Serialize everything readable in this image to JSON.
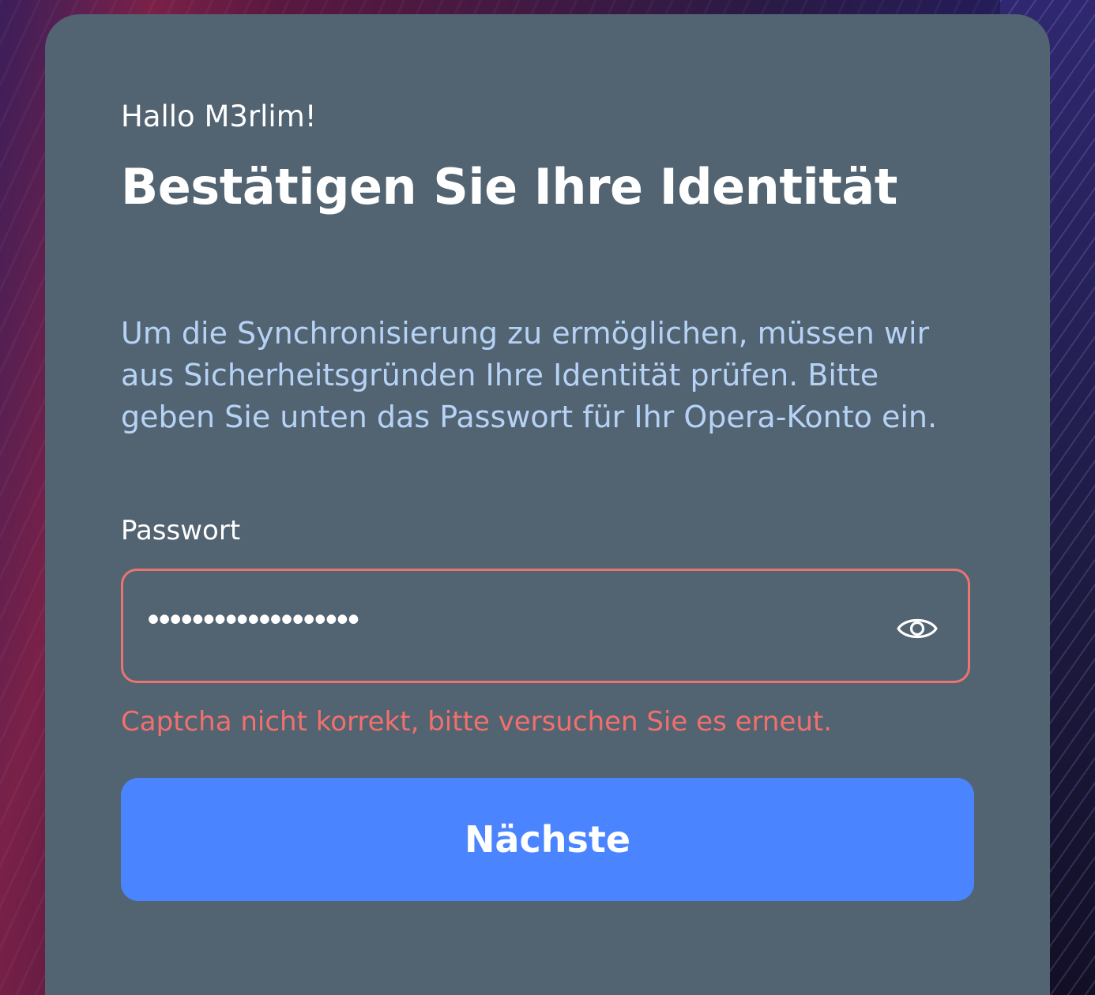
{
  "card": {
    "greeting": "Hallo M3rlim!",
    "title": "Bestätigen Sie Ihre Identität",
    "description": "Um die Synchronisierung zu ermöglichen, müssen wir aus Sicherheitsgründen Ihre Identität prüfen. Bitte geben Sie unten das Passwort für Ihr Opera-Konto ein."
  },
  "password": {
    "label": "Passwort",
    "masked_value": "•••••••••••••••••••",
    "toggle_icon": "eye-icon"
  },
  "error": {
    "message": "Captcha nicht korrekt, bitte versuchen Sie es erneut."
  },
  "next_button": {
    "label": "Nächste"
  },
  "colors": {
    "card_background": "#526372",
    "description_text": "#b6d3f6",
    "error": "#f2706c",
    "field_border": "#e97571",
    "primary_button": "#4a85ff"
  }
}
